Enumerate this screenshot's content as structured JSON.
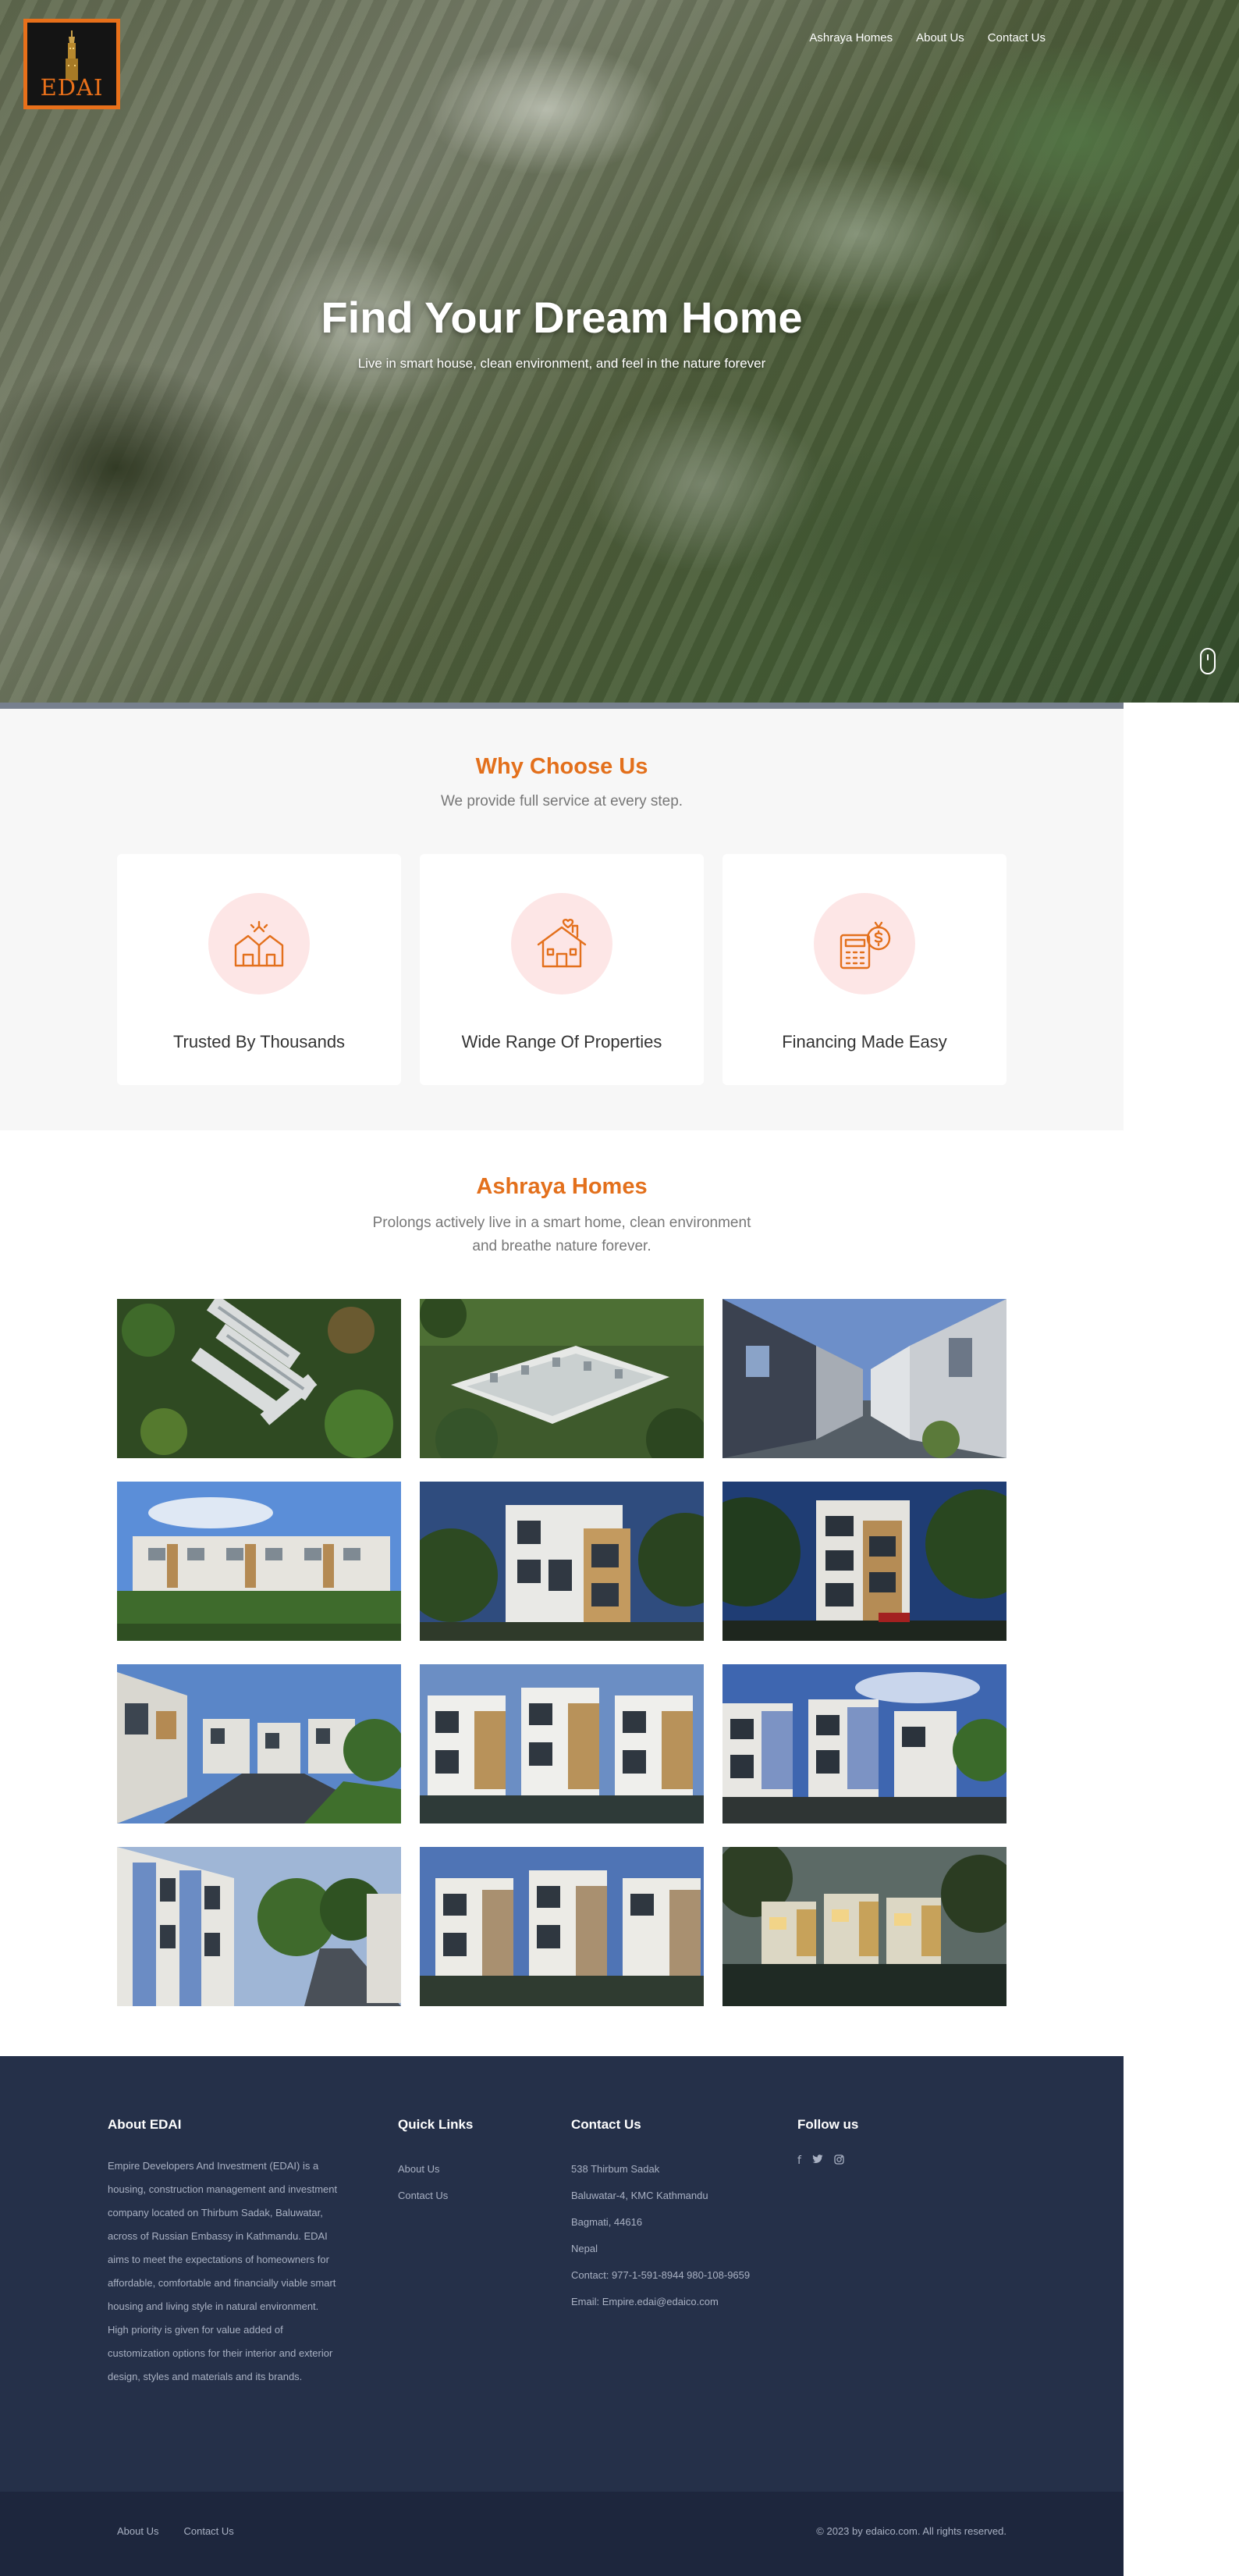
{
  "brand": {
    "logo_text": "EDAI",
    "accent": "#e8701a"
  },
  "nav": {
    "items": [
      {
        "label": "Ashraya Homes"
      },
      {
        "label": "About Us"
      },
      {
        "label": "Contact Us"
      }
    ]
  },
  "hero": {
    "title": "Find Your Dream Home",
    "subtitle": "Live in smart house, clean environment, and feel in the nature forever"
  },
  "why": {
    "title": "Why Choose Us",
    "subtitle": "We provide full service at every step.",
    "cards": [
      {
        "label": "Trusted By Thousands",
        "icon": "trust-hands-icon"
      },
      {
        "label": "Wide Range Of Properties",
        "icon": "house-heart-icon"
      },
      {
        "label": "Financing Made Easy",
        "icon": "calculator-money-icon"
      }
    ]
  },
  "homes": {
    "title": "Ashraya Homes",
    "subtitle_line1": "Prolongs actively live in a smart home, clean environment",
    "subtitle_line2": "and breathe nature forever."
  },
  "footer": {
    "about_title": "About EDAI",
    "about_text": "Empire Developers And Investment (EDAI) is a housing, construction management and investment company located on Thirbum Sadak, Baluwatar, across of Russian Embassy in Kathmandu. EDAI aims to meet the expectations of homeowners for affordable, comfortable and financially viable smart housing and living style in natural environment. High priority is given for value added of customization options for their interior and exterior design, styles and materials and its brands.",
    "quick_title": "Quick Links",
    "quick_links": [
      "About Us",
      "Contact Us"
    ],
    "contact_title": "Contact Us",
    "contact_lines": [
      "538 Thirbum Sadak",
      "Baluwatar-4, KMC Kathmandu",
      "Bagmati, 44616",
      "Nepal",
      "Contact: 977-1-591-8944 980-108-9659",
      "Email: Empire.edai@edaico.com"
    ],
    "follow_title": "Follow us",
    "social": [
      "f",
      "❁",
      "◎"
    ]
  },
  "bottom": {
    "links": [
      "About Us",
      "Contact Us"
    ],
    "copyright": "© 2023 by edaico.com. All rights reserved."
  }
}
